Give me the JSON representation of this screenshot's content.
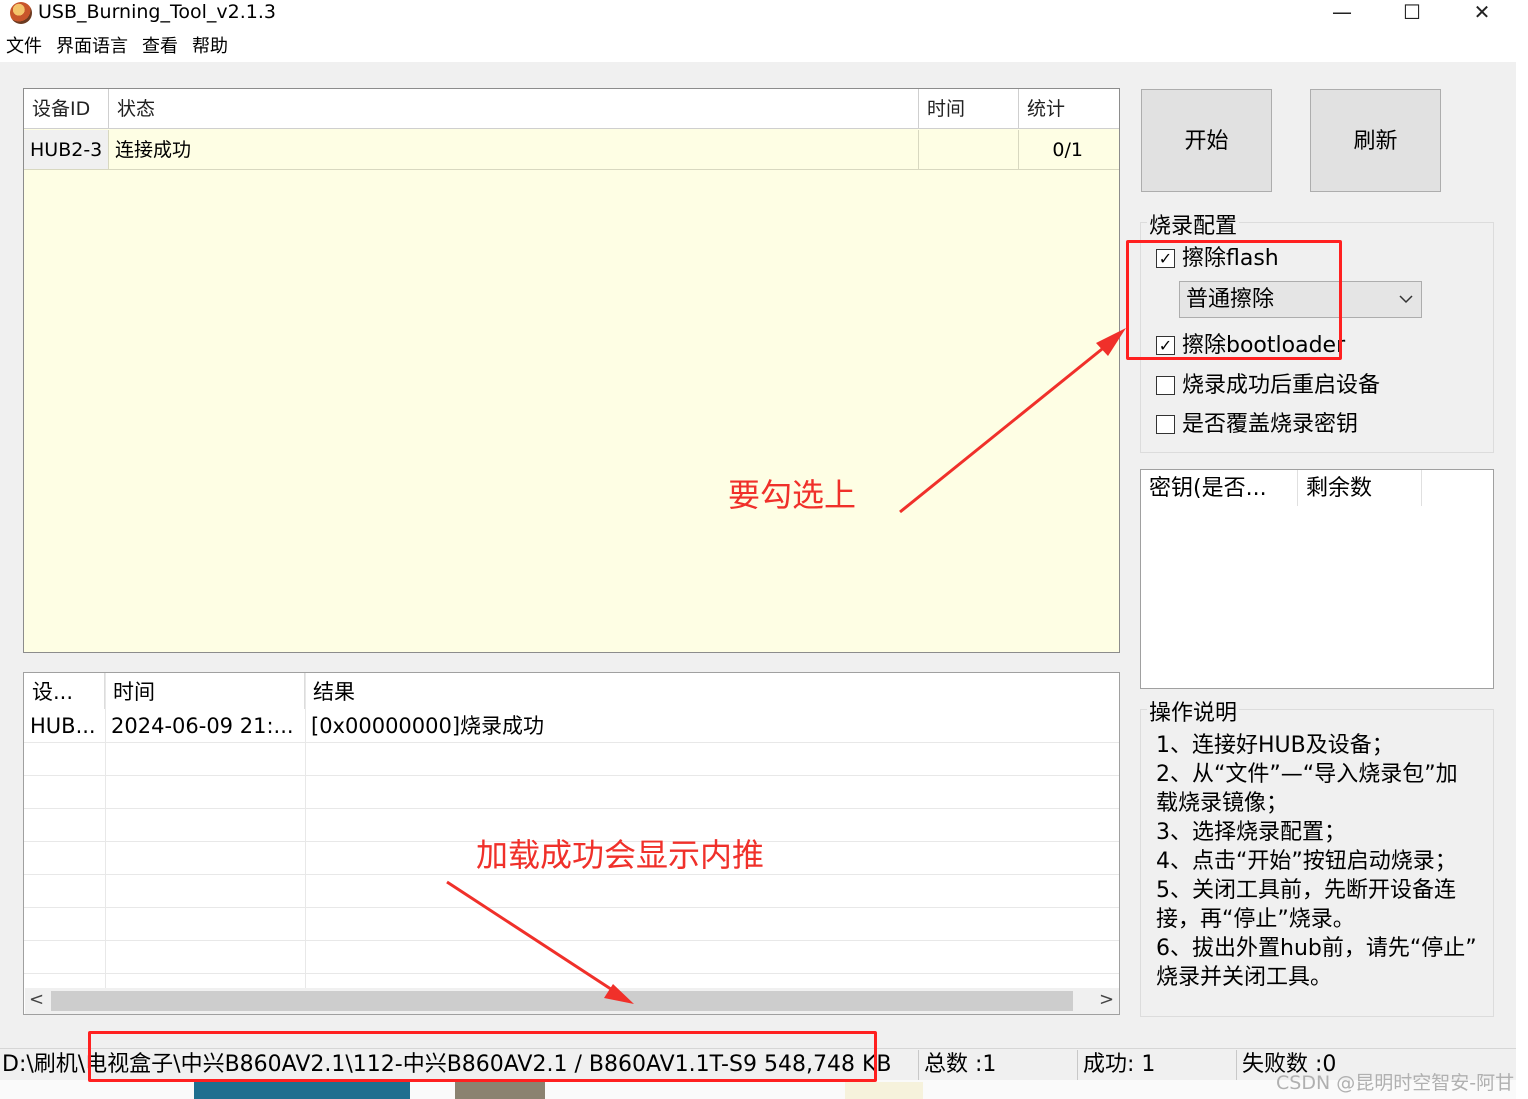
{
  "window": {
    "title": "USB_Burning_Tool_v2.1.3",
    "controls": {
      "minimize": "—",
      "maximize": "☐",
      "close": "✕"
    }
  },
  "menu": [
    "文件",
    "界面语言",
    "查看",
    "帮助"
  ],
  "device_table": {
    "headers": [
      "设备ID",
      "状态",
      "时间",
      "统计"
    ],
    "rows": [
      {
        "id": "HUB2-3",
        "status": "连接成功",
        "time": "",
        "stats": "0/1"
      }
    ]
  },
  "log_table": {
    "headers": [
      "设...",
      "时间",
      "结果"
    ],
    "rows": [
      {
        "device": "HUB...",
        "time": "2024-06-09 21:...",
        "result": "[0x00000000]烧录成功"
      }
    ],
    "scroll_left": "<",
    "scroll_right": ">"
  },
  "buttons": {
    "start": "开始",
    "refresh": "刷新"
  },
  "burn_config": {
    "title": "烧录配置",
    "erase_flash": {
      "label": "擦除flash",
      "checked": true
    },
    "erase_mode": "普通擦除",
    "erase_bootloader": {
      "label": "擦除bootloader",
      "checked": true
    },
    "reboot_after": {
      "label": "烧录成功后重启设备",
      "checked": false
    },
    "overwrite_key": {
      "label": "是否覆盖烧录密钥",
      "checked": false
    }
  },
  "key_table": {
    "headers": [
      "密钥(是否...",
      "剩余数"
    ]
  },
  "instructions": {
    "title": "操作说明",
    "lines": [
      "1、连接好HUB及设备；",
      "2、从“文件”—“导入烧录包”加",
      "载烧录镜像；",
      "3、选择烧录配置；",
      "4、点击“开始”按钮启动烧录；",
      "5、关闭工具前，先断开设备连",
      "接，再“停止”烧录。",
      "6、拔出外置hub前，请先“停止”",
      "烧录并关闭工具。"
    ]
  },
  "status_bar": {
    "path": "D:\\刷机\\电视盒子\\中兴B860AV2.1\\112-中兴B860AV2.1 / B860AV1.1T-S9",
    "size": "548,748 KB",
    "total": "总数 :1",
    "success": "成功:  1",
    "failed": "失败数 :0"
  },
  "annotations": {
    "check_note": "要勾选上",
    "load_note": "加载成功会显示内推"
  },
  "watermark": "CSDN @昆明时空智安-阿甘",
  "colors": {
    "annotation": "#f0302a",
    "device_table_bg": "#fefee4"
  }
}
